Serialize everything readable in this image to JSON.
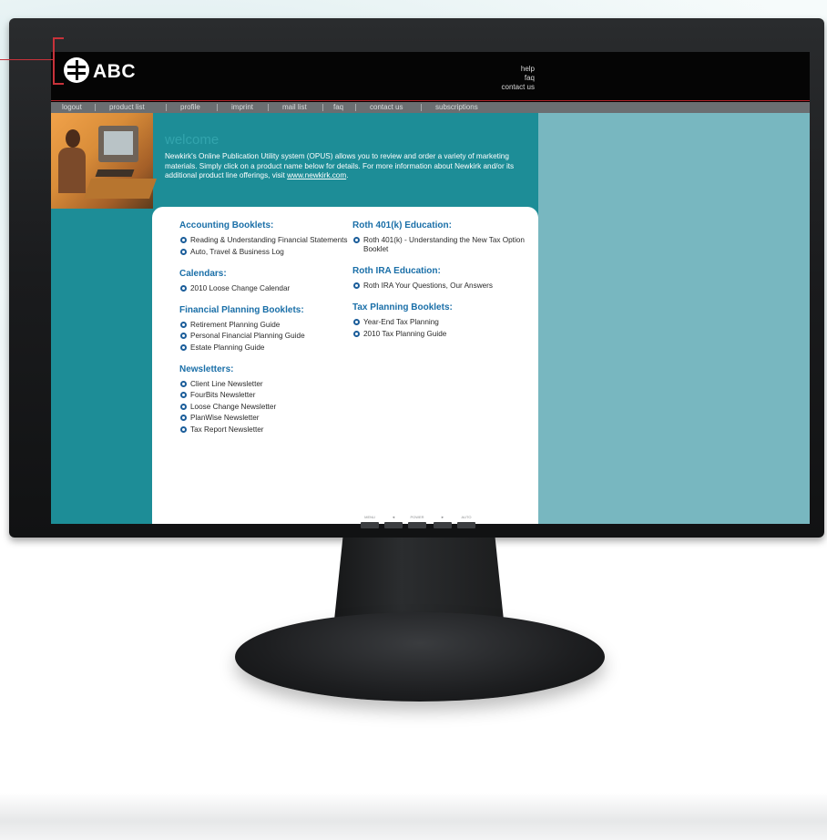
{
  "header": {
    "logo_text": "ABC",
    "links": [
      "help",
      "faq",
      "contact us"
    ]
  },
  "nav": {
    "items": [
      "logout",
      "product list",
      "profile",
      "imprint",
      "mail list",
      "faq",
      "contact us",
      "subscriptions"
    ]
  },
  "welcome": {
    "title": "welcome",
    "intro": "Newkirk's Online Publication Utility system (OPUS) allows you to review and order a variety of marketing materials. Simply click on a product name below for details. For more information about Newkirk and/or its additional product line offerings, visit ",
    "link_text": "www.newkirk.com",
    "link_suffix": "."
  },
  "catalog": {
    "left": [
      {
        "title": "Accounting Booklets:",
        "items": [
          "Reading & Understanding Financial Statements",
          "Auto, Travel & Business Log"
        ]
      },
      {
        "title": "Calendars:",
        "items": [
          "2010 Loose Change Calendar"
        ]
      },
      {
        "title": "Financial Planning Booklets:",
        "items": [
          "Retirement Planning Guide",
          "Personal Financial Planning Guide",
          "Estate Planning Guide"
        ]
      },
      {
        "title": "Newsletters:",
        "items": [
          "Client Line Newsletter",
          "FourBits Newsletter",
          "Loose Change Newsletter",
          "PlanWise Newsletter",
          "Tax Report Newsletter"
        ]
      }
    ],
    "right": [
      {
        "title": "Roth 401(k) Education:",
        "items": [
          "Roth 401(k) - Understanding the New Tax Option Booklet"
        ]
      },
      {
        "title": "Roth IRA Education:",
        "items": [
          "Roth IRA Your Questions, Our Answers"
        ]
      },
      {
        "title": "Tax Planning Booklets:",
        "items": [
          "Year-End Tax Planning",
          "2010 Tax Planning Guide"
        ]
      }
    ]
  },
  "monitor": {
    "buttons": [
      "MENU",
      "◄",
      "POWER",
      "►",
      "AUTO"
    ]
  },
  "colors": {
    "teal": "#1d8d97",
    "right_panel": "#78b7c0",
    "section_title": "#1a6fa8",
    "callout": "#c8323a"
  }
}
